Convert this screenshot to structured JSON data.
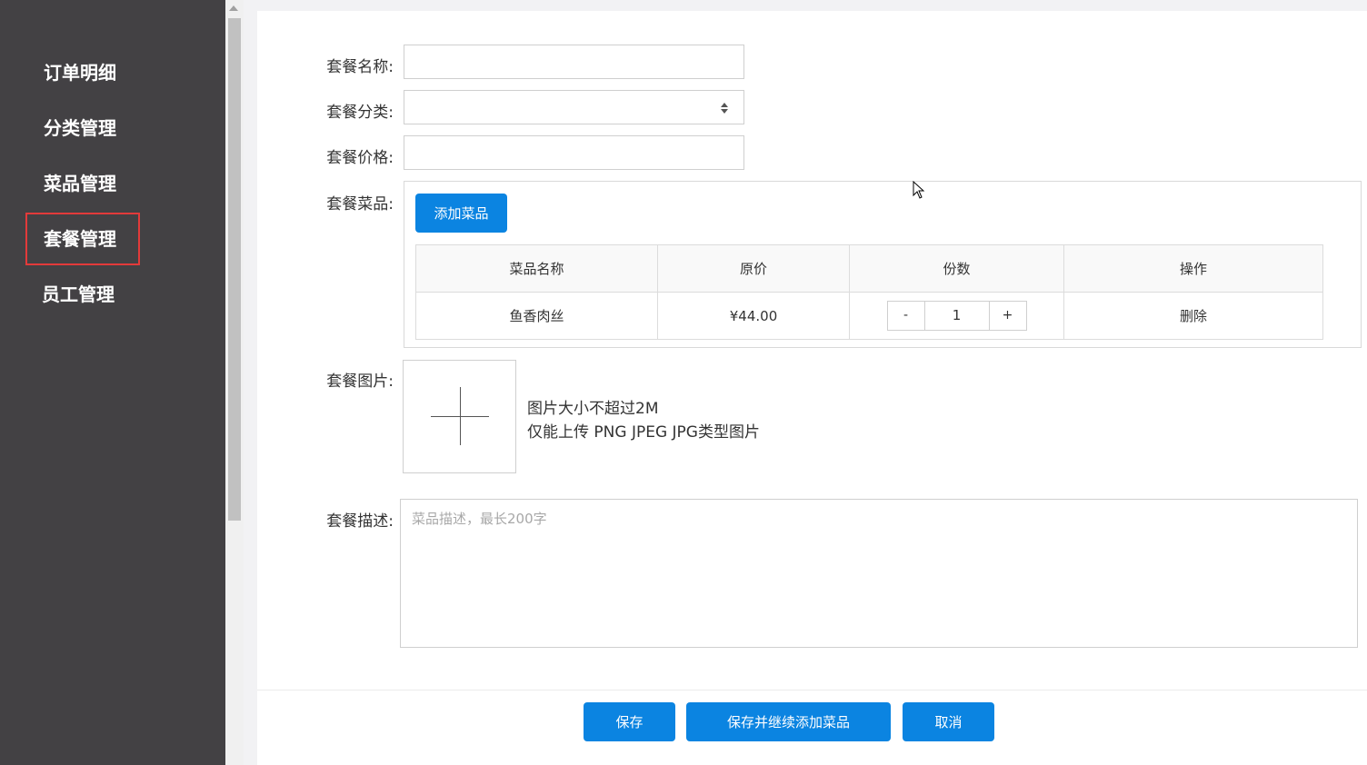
{
  "sidebar": {
    "items": [
      {
        "label": "订单明细"
      },
      {
        "label": "分类管理"
      },
      {
        "label": "菜品管理"
      },
      {
        "label": "套餐管理",
        "active": true
      },
      {
        "label": "员工管理"
      }
    ]
  },
  "form": {
    "name_label": "套餐名称:",
    "name_value": "",
    "category_label": "套餐分类:",
    "category_value": "",
    "price_label": "套餐价格:",
    "price_value": "",
    "dishes_label": "套餐菜品:",
    "add_dish_button": "添加菜品",
    "table": {
      "headers": [
        "菜品名称",
        "原价",
        "份数",
        "操作"
      ],
      "rows": [
        {
          "name": "鱼香肉丝",
          "price": "¥44.00",
          "decrement": "-",
          "quantity": "1",
          "increment": "+",
          "action": "删除"
        }
      ]
    },
    "image_label": "套餐图片:",
    "image_hint_size": "图片大小不超过2M",
    "image_hint_types": "仅能上传 PNG JPEG JPG类型图片",
    "desc_label": "套餐描述:",
    "desc_placeholder": "菜品描述，最长200字"
  },
  "footer": {
    "save": "保存",
    "save_continue": "保存并继续添加菜品",
    "cancel": "取消"
  },
  "colors": {
    "sidebar_bg": "#434144",
    "primary": "#0b84e1",
    "active_border": "#e33a3a"
  }
}
